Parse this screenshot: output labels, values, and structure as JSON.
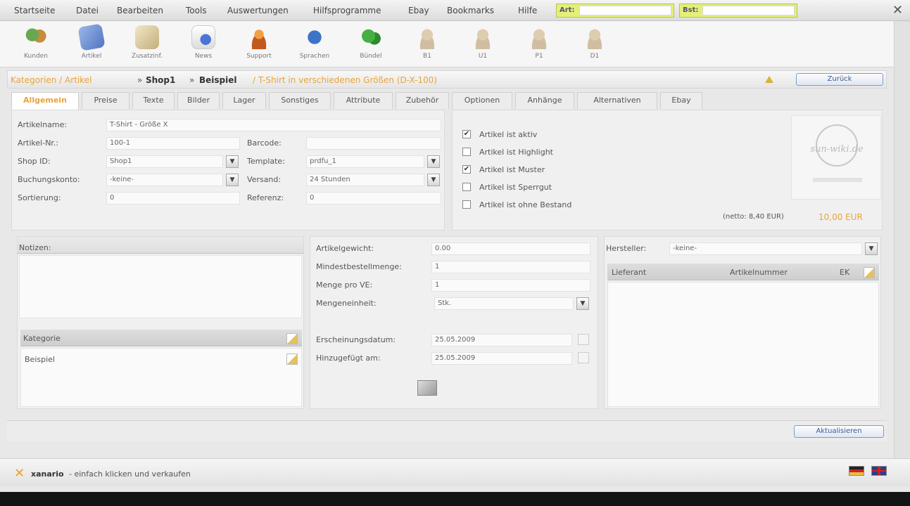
{
  "menu": [
    "Startseite",
    "Datei",
    "Bearbeiten",
    "Tools",
    "Auswertungen",
    "Hilfsprogramme",
    "Ebay",
    "Bookmarks",
    "Hilfe"
  ],
  "search": [
    {
      "label": "Art:",
      "value": ""
    },
    {
      "label": "Bst:",
      "value": ""
    }
  ],
  "toolbar": [
    {
      "label": "Kunden",
      "icon": "customers-icon"
    },
    {
      "label": "Artikel",
      "icon": "article-icon"
    },
    {
      "label": "Zusatzinf.",
      "icon": "notes-icon"
    },
    {
      "label": "News",
      "icon": "news-icon"
    },
    {
      "label": "Support",
      "icon": "support-icon"
    },
    {
      "label": "Sprachen",
      "icon": "globe-icon"
    },
    {
      "label": "Bündel",
      "icon": "bundle-icon"
    },
    {
      "label": "B1",
      "icon": "user-icon"
    },
    {
      "label": "U1",
      "icon": "user-icon"
    },
    {
      "label": "P1",
      "icon": "user-icon"
    },
    {
      "label": "D1",
      "icon": "user-icon"
    }
  ],
  "breadcrumb": {
    "path": "Kategorien / Artikel",
    "shop": "Shop1",
    "category": "Beispiel",
    "article": "/ T-Shirt in verschiedenen Größen (D-X-100)",
    "back_label": "Zurück"
  },
  "tabs": [
    "Allgemein",
    "Preise",
    "Texte",
    "Bilder",
    "Lager",
    "Sonstiges",
    "Attribute",
    "Zubehör",
    "Optionen",
    "Anhänge",
    "Alternativen",
    "Ebay"
  ],
  "general": {
    "name_label": "Artikelname:",
    "name_value": "T-Shirt - Größe X",
    "nr_label": "Artikel-Nr.:",
    "nr_value": "100-1",
    "barcode_label": "Barcode:",
    "barcode_value": "",
    "shop_label": "Shop ID:",
    "shop_value": "Shop1",
    "template_label": "Template:",
    "template_value": "prdfu_1",
    "booking_label": "Buchungskonto:",
    "booking_value": "-keine-",
    "shipping_label": "Versand:",
    "shipping_value": "24 Stunden",
    "sort_label": "Sortierung:",
    "sort_value": "0",
    "ref_label": "Referenz:",
    "ref_value": "0"
  },
  "flags": [
    {
      "label": "Artikel ist aktiv",
      "checked": true
    },
    {
      "label": "Artikel ist Highlight",
      "checked": false
    },
    {
      "label": "Artikel ist Muster",
      "checked": true
    },
    {
      "label": "Artikel ist Sperrgut",
      "checked": false
    },
    {
      "label": "Artikel ist ohne Bestand",
      "checked": false
    }
  ],
  "logo_text": "sun-wiki.de",
  "price": {
    "netto": "(netto: 8,40 EUR)",
    "brutto": "10,00 EUR"
  },
  "notes_label": "Notizen:",
  "category": {
    "header": "Kategorie",
    "item": "Beispiel"
  },
  "details": {
    "weight_label": "Artikelgewicht:",
    "weight_value": "0.00",
    "minorder_label": "Mindestbestellmenge:",
    "minorder_value": "1",
    "perve_label": "Menge pro VE:",
    "perve_value": "1",
    "unit_label": "Mengeneinheit:",
    "unit_value": "Stk.",
    "release_label": "Erscheinungsdatum:",
    "release_value": "25.05.2009",
    "added_label": "Hinzugefügt am:",
    "added_value": "25.05.2009"
  },
  "supplier": {
    "label": "Hersteller:",
    "value": "-keine-",
    "col1": "Lieferant",
    "col2": "Artikelnummer",
    "col3": "EK"
  },
  "refresh_label": "Aktualisieren",
  "footer": {
    "brand": "xanario",
    "text": "- einfach klicken und verkaufen"
  }
}
